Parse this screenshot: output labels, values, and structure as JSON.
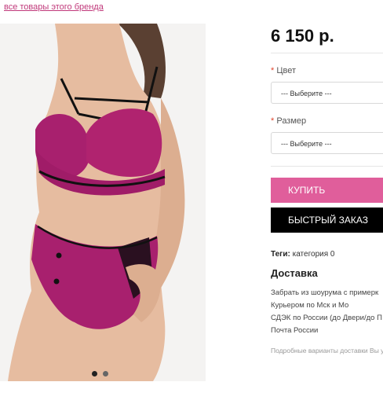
{
  "brand_link": "все товары этого бренда",
  "price": "6 150 р.",
  "options": [
    {
      "label": "Цвет",
      "placeholder": "--- Выберите ---"
    },
    {
      "label": "Размер",
      "placeholder": "--- Выберите ---"
    }
  ],
  "buttons": {
    "buy": "КУПИТЬ",
    "quick": "БЫСТРЫЙ ЗАКАЗ"
  },
  "tags": {
    "label": "Теги:",
    "value": "категория 0"
  },
  "delivery": {
    "title": "Доставка",
    "items": [
      "Забрать из шоурума с примерк",
      "Курьером по Мск и Мо",
      "СДЭК по России (до Двери/до П",
      "Почта России"
    ],
    "note": "Подробные варианты доставки Вы у"
  },
  "gallery": {
    "slides": 2,
    "active": 1
  },
  "colors": {
    "accent": "#e05e9b",
    "quick_button": "#000000",
    "link": "#c0387a",
    "product": "#a8206e"
  }
}
